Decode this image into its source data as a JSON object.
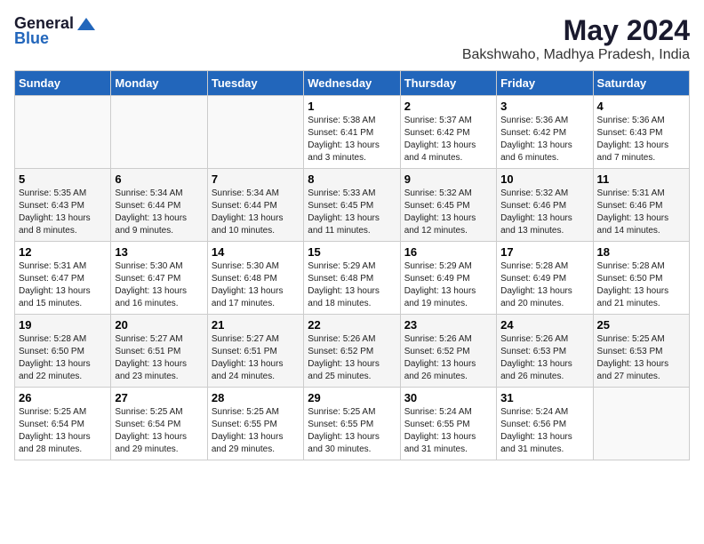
{
  "logo": {
    "general": "General",
    "blue": "Blue"
  },
  "title": "May 2024",
  "location": "Bakshwaho, Madhya Pradesh, India",
  "weekdays": [
    "Sunday",
    "Monday",
    "Tuesday",
    "Wednesday",
    "Thursday",
    "Friday",
    "Saturday"
  ],
  "weeks": [
    [
      {
        "day": "",
        "sunrise": "",
        "sunset": "",
        "daylight": ""
      },
      {
        "day": "",
        "sunrise": "",
        "sunset": "",
        "daylight": ""
      },
      {
        "day": "",
        "sunrise": "",
        "sunset": "",
        "daylight": ""
      },
      {
        "day": "1",
        "sunrise": "Sunrise: 5:38 AM",
        "sunset": "Sunset: 6:41 PM",
        "daylight": "Daylight: 13 hours and 3 minutes."
      },
      {
        "day": "2",
        "sunrise": "Sunrise: 5:37 AM",
        "sunset": "Sunset: 6:42 PM",
        "daylight": "Daylight: 13 hours and 4 minutes."
      },
      {
        "day": "3",
        "sunrise": "Sunrise: 5:36 AM",
        "sunset": "Sunset: 6:42 PM",
        "daylight": "Daylight: 13 hours and 6 minutes."
      },
      {
        "day": "4",
        "sunrise": "Sunrise: 5:36 AM",
        "sunset": "Sunset: 6:43 PM",
        "daylight": "Daylight: 13 hours and 7 minutes."
      }
    ],
    [
      {
        "day": "5",
        "sunrise": "Sunrise: 5:35 AM",
        "sunset": "Sunset: 6:43 PM",
        "daylight": "Daylight: 13 hours and 8 minutes."
      },
      {
        "day": "6",
        "sunrise": "Sunrise: 5:34 AM",
        "sunset": "Sunset: 6:44 PM",
        "daylight": "Daylight: 13 hours and 9 minutes."
      },
      {
        "day": "7",
        "sunrise": "Sunrise: 5:34 AM",
        "sunset": "Sunset: 6:44 PM",
        "daylight": "Daylight: 13 hours and 10 minutes."
      },
      {
        "day": "8",
        "sunrise": "Sunrise: 5:33 AM",
        "sunset": "Sunset: 6:45 PM",
        "daylight": "Daylight: 13 hours and 11 minutes."
      },
      {
        "day": "9",
        "sunrise": "Sunrise: 5:32 AM",
        "sunset": "Sunset: 6:45 PM",
        "daylight": "Daylight: 13 hours and 12 minutes."
      },
      {
        "day": "10",
        "sunrise": "Sunrise: 5:32 AM",
        "sunset": "Sunset: 6:46 PM",
        "daylight": "Daylight: 13 hours and 13 minutes."
      },
      {
        "day": "11",
        "sunrise": "Sunrise: 5:31 AM",
        "sunset": "Sunset: 6:46 PM",
        "daylight": "Daylight: 13 hours and 14 minutes."
      }
    ],
    [
      {
        "day": "12",
        "sunrise": "Sunrise: 5:31 AM",
        "sunset": "Sunset: 6:47 PM",
        "daylight": "Daylight: 13 hours and 15 minutes."
      },
      {
        "day": "13",
        "sunrise": "Sunrise: 5:30 AM",
        "sunset": "Sunset: 6:47 PM",
        "daylight": "Daylight: 13 hours and 16 minutes."
      },
      {
        "day": "14",
        "sunrise": "Sunrise: 5:30 AM",
        "sunset": "Sunset: 6:48 PM",
        "daylight": "Daylight: 13 hours and 17 minutes."
      },
      {
        "day": "15",
        "sunrise": "Sunrise: 5:29 AM",
        "sunset": "Sunset: 6:48 PM",
        "daylight": "Daylight: 13 hours and 18 minutes."
      },
      {
        "day": "16",
        "sunrise": "Sunrise: 5:29 AM",
        "sunset": "Sunset: 6:49 PM",
        "daylight": "Daylight: 13 hours and 19 minutes."
      },
      {
        "day": "17",
        "sunrise": "Sunrise: 5:28 AM",
        "sunset": "Sunset: 6:49 PM",
        "daylight": "Daylight: 13 hours and 20 minutes."
      },
      {
        "day": "18",
        "sunrise": "Sunrise: 5:28 AM",
        "sunset": "Sunset: 6:50 PM",
        "daylight": "Daylight: 13 hours and 21 minutes."
      }
    ],
    [
      {
        "day": "19",
        "sunrise": "Sunrise: 5:28 AM",
        "sunset": "Sunset: 6:50 PM",
        "daylight": "Daylight: 13 hours and 22 minutes."
      },
      {
        "day": "20",
        "sunrise": "Sunrise: 5:27 AM",
        "sunset": "Sunset: 6:51 PM",
        "daylight": "Daylight: 13 hours and 23 minutes."
      },
      {
        "day": "21",
        "sunrise": "Sunrise: 5:27 AM",
        "sunset": "Sunset: 6:51 PM",
        "daylight": "Daylight: 13 hours and 24 minutes."
      },
      {
        "day": "22",
        "sunrise": "Sunrise: 5:26 AM",
        "sunset": "Sunset: 6:52 PM",
        "daylight": "Daylight: 13 hours and 25 minutes."
      },
      {
        "day": "23",
        "sunrise": "Sunrise: 5:26 AM",
        "sunset": "Sunset: 6:52 PM",
        "daylight": "Daylight: 13 hours and 26 minutes."
      },
      {
        "day": "24",
        "sunrise": "Sunrise: 5:26 AM",
        "sunset": "Sunset: 6:53 PM",
        "daylight": "Daylight: 13 hours and 26 minutes."
      },
      {
        "day": "25",
        "sunrise": "Sunrise: 5:25 AM",
        "sunset": "Sunset: 6:53 PM",
        "daylight": "Daylight: 13 hours and 27 minutes."
      }
    ],
    [
      {
        "day": "26",
        "sunrise": "Sunrise: 5:25 AM",
        "sunset": "Sunset: 6:54 PM",
        "daylight": "Daylight: 13 hours and 28 minutes."
      },
      {
        "day": "27",
        "sunrise": "Sunrise: 5:25 AM",
        "sunset": "Sunset: 6:54 PM",
        "daylight": "Daylight: 13 hours and 29 minutes."
      },
      {
        "day": "28",
        "sunrise": "Sunrise: 5:25 AM",
        "sunset": "Sunset: 6:55 PM",
        "daylight": "Daylight: 13 hours and 29 minutes."
      },
      {
        "day": "29",
        "sunrise": "Sunrise: 5:25 AM",
        "sunset": "Sunset: 6:55 PM",
        "daylight": "Daylight: 13 hours and 30 minutes."
      },
      {
        "day": "30",
        "sunrise": "Sunrise: 5:24 AM",
        "sunset": "Sunset: 6:55 PM",
        "daylight": "Daylight: 13 hours and 31 minutes."
      },
      {
        "day": "31",
        "sunrise": "Sunrise: 5:24 AM",
        "sunset": "Sunset: 6:56 PM",
        "daylight": "Daylight: 13 hours and 31 minutes."
      },
      {
        "day": "",
        "sunrise": "",
        "sunset": "",
        "daylight": ""
      }
    ]
  ]
}
